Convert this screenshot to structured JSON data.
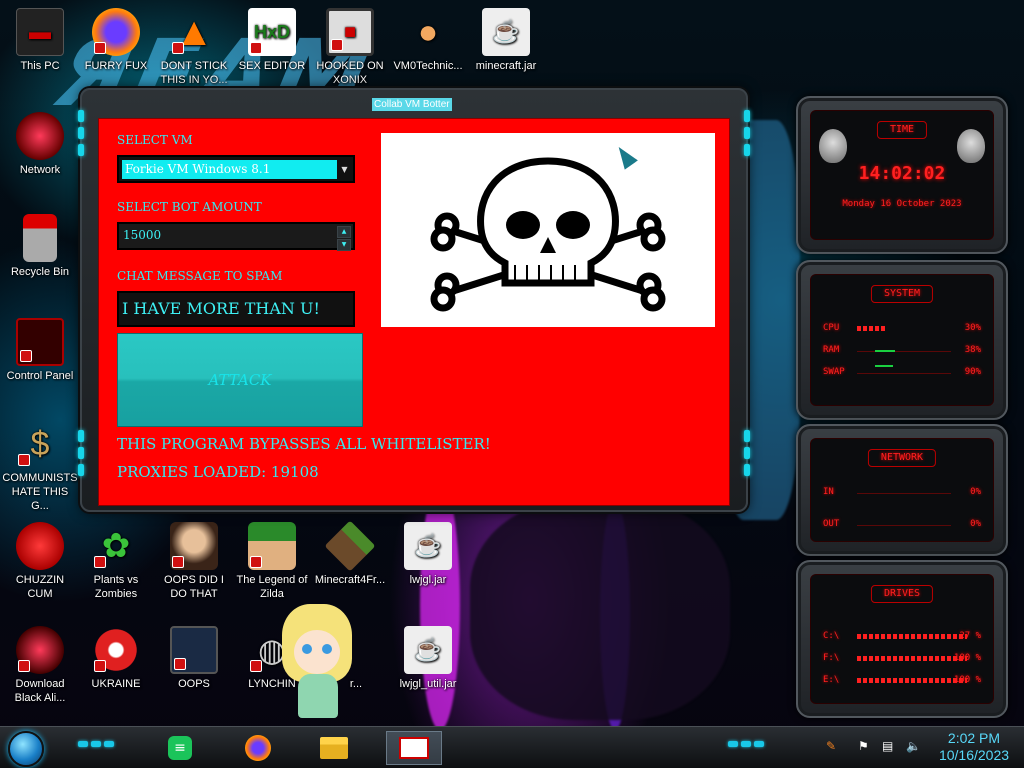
{
  "window": {
    "title": "Collab VM Botter",
    "select_vm_label": "SELECT VM",
    "selected_vm": "Forkie VM Windows 8.1",
    "bot_amount_label": "SELECT BOT AMOUNT",
    "bot_amount": "15000",
    "chat_label": "CHAT MESSAGE TO SPAM",
    "chat_message": "I HAVE MORE THAN U!",
    "attack_label": "ATTACK",
    "bypass_text": "THIS PROGRAM BYPASSES ALL WHITELISTER!",
    "proxies_text": "PROXIES LOADED: 19108"
  },
  "desktop_icons": [
    {
      "label": "This PC",
      "icon": "computer-icon"
    },
    {
      "label": "FURRY FUX",
      "icon": "firefox-icon"
    },
    {
      "label": "DONT STICK THIS IN YO...",
      "icon": "vlc-cone-icon"
    },
    {
      "label": "SEX EDITOR",
      "icon": "hex-editor-icon"
    },
    {
      "label": "HOOKED ON XONIX",
      "icon": "xonix-icon"
    },
    {
      "label": "VM0Technic...",
      "icon": "doctor-icon"
    },
    {
      "label": "minecraft.jar",
      "icon": "java-icon"
    },
    {
      "label": "Network",
      "icon": "network-orb-icon"
    },
    {
      "label": "Recycle Bin",
      "icon": "recycle-bin-icon"
    },
    {
      "label": "Control Panel",
      "icon": "control-panel-icon"
    },
    {
      "label": "COMMUNISTS HATE THIS G...",
      "icon": "money-bag-icon"
    },
    {
      "label": "CHUZZIN CUM",
      "icon": "chuzzle-icon"
    },
    {
      "label": "Plants vs Zombies",
      "icon": "plant-icon"
    },
    {
      "label": "OOPS DID I DO THAT",
      "icon": "portrait-icon"
    },
    {
      "label": "The Legend of Zilda",
      "icon": "zelda-icon"
    },
    {
      "label": "Minecraft4Fr...",
      "icon": "minecraft-block-icon"
    },
    {
      "label": "lwjgl.jar",
      "icon": "java-icon"
    },
    {
      "label": "Download Black Ali...",
      "icon": "alien-orb-icon"
    },
    {
      "label": "UKRAINE",
      "icon": "radiation-icon"
    },
    {
      "label": "OOPS",
      "icon": "oops-icon"
    },
    {
      "label": "LYNCHIN",
      "icon": "lynch-icon"
    },
    {
      "label": "r...",
      "icon": "shortcut-icon"
    },
    {
      "label": "lwjgl_util.jar",
      "icon": "java-icon"
    }
  ],
  "gadgets": {
    "time": {
      "title": "TIME",
      "clock": "14:02:02",
      "date": "Monday 16 October 2023"
    },
    "system": {
      "title": "SYSTEM",
      "rows": [
        {
          "label": "CPU",
          "value": "30%",
          "level": 0.3
        },
        {
          "label": "RAM",
          "value": "38%",
          "level": 0.38
        },
        {
          "label": "SWAP",
          "value": "90%",
          "level": 0.9
        }
      ]
    },
    "network": {
      "title": "NETWORK",
      "in": "IN",
      "in_value": "0%",
      "out": "OUT",
      "out_value": "0%"
    },
    "drives": {
      "title": "DRIVES",
      "rows": [
        {
          "label": "C:\\",
          "value": "27 %",
          "level": 0.27
        },
        {
          "label": "F:\\",
          "value": "100 %",
          "level": 1.0
        },
        {
          "label": "E:\\",
          "value": "100 %",
          "level": 1.0
        }
      ]
    }
  },
  "taskbar": {
    "time": "2:02 PM",
    "date": "10/16/2023",
    "pinned": [
      "chat-app-icon",
      "firefox-icon",
      "file-explorer-icon",
      "botter-app-icon"
    ]
  },
  "colors": {
    "window_bg": "#ff0000",
    "accent": "#36e8f0",
    "gadget_red": "#ff2020"
  }
}
